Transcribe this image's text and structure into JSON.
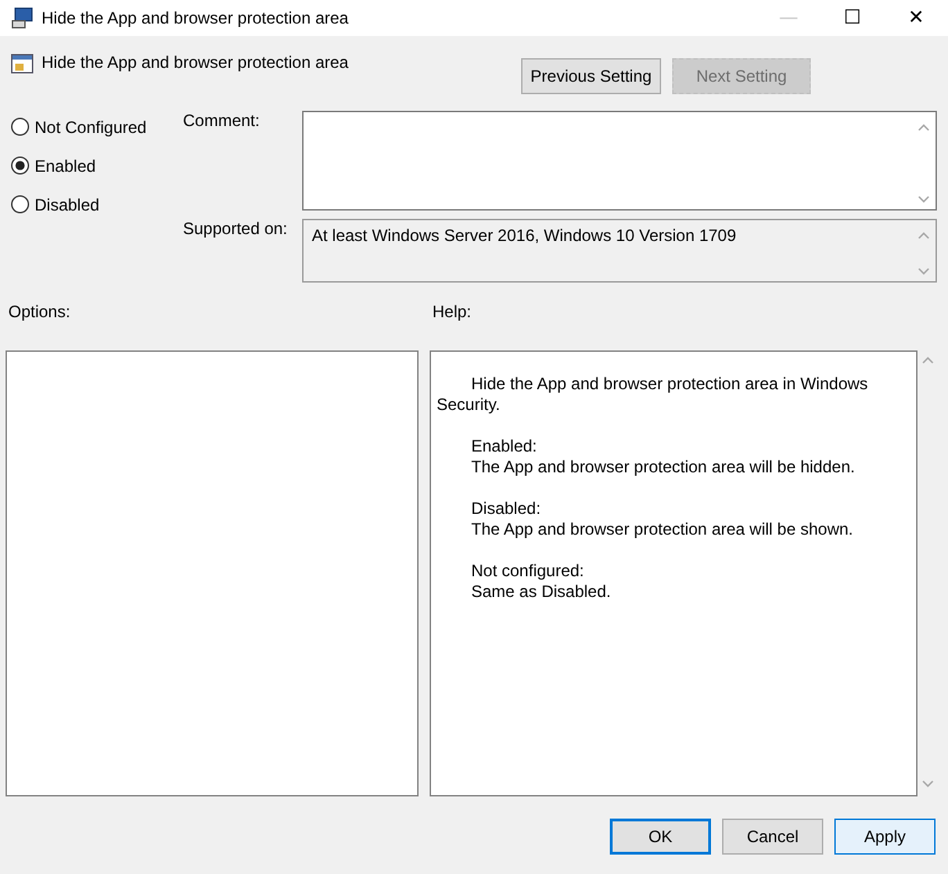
{
  "window": {
    "title": "Hide the App and browser protection area",
    "controls": [
      "—",
      "☐",
      "✕"
    ]
  },
  "header": {
    "title": "Hide the App and browser protection area"
  },
  "nav_buttons": [
    {
      "label": "Previous Setting",
      "disabled": false
    },
    {
      "label": "Next Setting",
      "disabled": true
    }
  ],
  "state_options": [
    {
      "label": "Not Configured",
      "selected": false
    },
    {
      "label": "Enabled",
      "selected": true
    },
    {
      "label": "Disabled",
      "selected": false
    }
  ],
  "comment": {
    "label": "Comment:"
  },
  "supported_on": {
    "label": "Supported on:",
    "value": "At least Windows Server 2016, Windows 10 Version 1709"
  },
  "options": {
    "label": "Options:"
  },
  "help": {
    "label": "Help:",
    "paragraphs": [
      {
        "kind": "lead",
        "lines": [
          "Hide the App and browser protection area in Windows Security."
        ]
      },
      {
        "kind": "indented",
        "lines": [
          "Enabled:",
          "The App and browser protection area will be hidden."
        ]
      },
      {
        "kind": "indented",
        "lines": [
          "Disabled:",
          "The App and browser protection area will be shown."
        ]
      },
      {
        "kind": "indented",
        "lines": [
          "Not configured:",
          "Same as Disabled."
        ]
      }
    ]
  },
  "buttons": [
    {
      "label": "OK",
      "kind": "default"
    },
    {
      "label": "Cancel",
      "kind": "normal"
    },
    {
      "label": "Apply",
      "kind": "hover"
    }
  ]
}
